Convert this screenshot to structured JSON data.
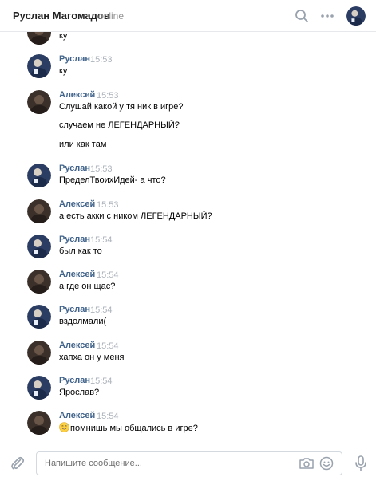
{
  "header": {
    "name": "Руслан Магомадов",
    "status": "online"
  },
  "composer": {
    "placeholder": "Напишите сообщение..."
  },
  "messages": [
    {
      "lines": [
        "ку"
      ]
    },
    {
      "author": "Руслан",
      "time": "15:53",
      "lines": [
        "ку"
      ]
    },
    {
      "author": "Алексей",
      "time": "15:53",
      "lines": [
        "Слушай какой у тя ник в игре?",
        "случаем не ЛЕГЕНДАРНЫЙ?",
        "или как там"
      ]
    },
    {
      "author": "Руслан",
      "time": "15:53",
      "lines": [
        "ПределТвоихИдей- а что?"
      ]
    },
    {
      "author": "Алексей",
      "time": "15:53",
      "lines": [
        "а есть акки с ником ЛЕГЕНДАРНЫЙ?"
      ]
    },
    {
      "author": "Руслан",
      "time": "15:54",
      "lines": [
        "был как то"
      ]
    },
    {
      "author": "Алексей",
      "time": "15:54",
      "lines": [
        "а где он щас?"
      ]
    },
    {
      "author": "Руслан",
      "time": "15:54",
      "lines": [
        "вздолмали("
      ]
    },
    {
      "author": "Алексей",
      "time": "15:54",
      "lines": [
        "хапха он у меня"
      ]
    },
    {
      "author": "Руслан",
      "time": "15:54",
      "lines": [
        "Ярослав?"
      ]
    },
    {
      "author": "Алексей",
      "time": "15:54",
      "lines": [
        "помнишь мы общались в игре?"
      ],
      "emoji": "sweat-smile-emoji"
    }
  ]
}
